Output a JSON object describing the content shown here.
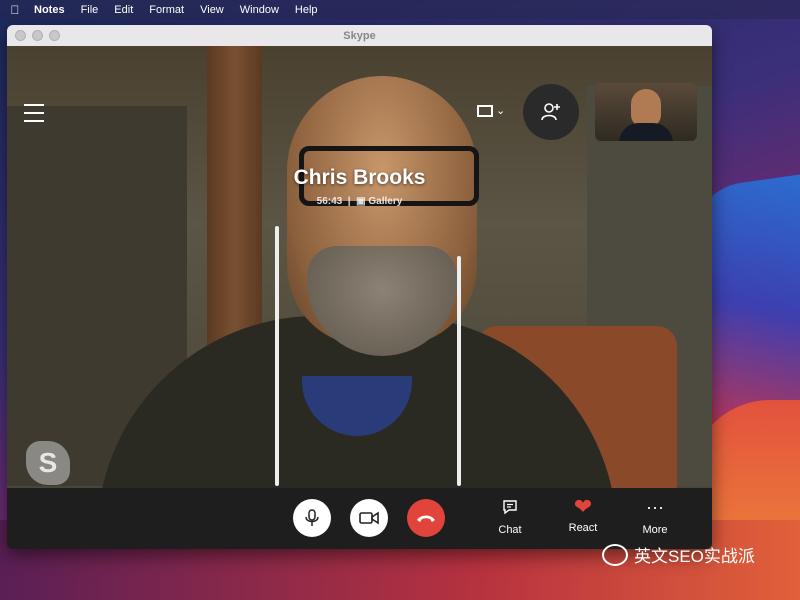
{
  "menubar": {
    "items": [
      "Notes",
      "File",
      "Edit",
      "Format",
      "View",
      "Window",
      "Help"
    ]
  },
  "window": {
    "title": "Skype"
  },
  "call": {
    "caller_name": "Chris Brooks",
    "duration": "56:43",
    "separator": "|",
    "view_mode": "Gallery"
  },
  "controls": {
    "chat_label": "Chat",
    "react_label": "React",
    "more_label": "More"
  },
  "watermark": {
    "text": "英文SEO实战派"
  },
  "colors": {
    "end_call": "#e0443a",
    "react_heart": "#e0443a",
    "control_bar": "#1e1e1e"
  }
}
